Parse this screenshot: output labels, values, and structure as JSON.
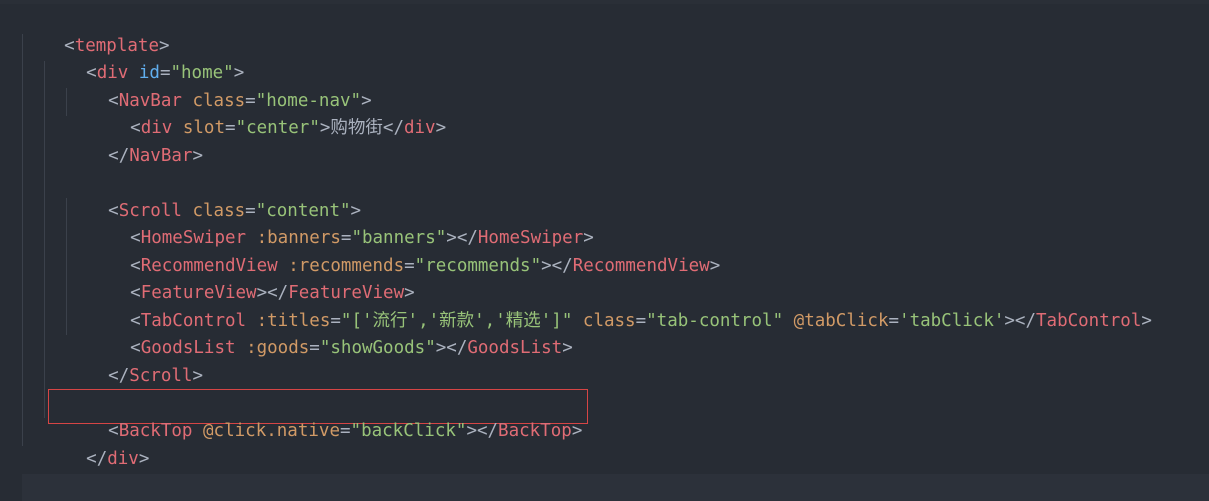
{
  "code": {
    "template_tag": "template",
    "div_tag": "div",
    "div_id_attr": "id",
    "div_id_value": "\"home\"",
    "navbar_tag": "NavBar",
    "navbar_class_attr": "class",
    "navbar_class_value": "\"home-nav\"",
    "center_div_slot_attr": "slot",
    "center_div_slot_value": "\"center\"",
    "center_div_text": "购物街",
    "scroll_tag": "Scroll",
    "scroll_class_attr": "class",
    "scroll_class_value": "\"content\"",
    "homeswiper_tag": "HomeSwiper",
    "homeswiper_attr": ":banners",
    "homeswiper_value": "\"banners\"",
    "recommend_tag": "RecommendView",
    "recommend_attr": ":recommends",
    "recommend_value": "\"recommends\"",
    "feature_tag": "FeatureView",
    "tabcontrol_tag": "TabControl",
    "tabcontrol_titles_attr": ":titles",
    "tabcontrol_titles_value": "\"['流行','新款','精选']\"",
    "tabcontrol_class_attr": "class",
    "tabcontrol_class_value": "\"tab-control\"",
    "tabcontrol_event_attr": "@tabClick",
    "tabcontrol_event_value": "'tabClick'",
    "goodslist_tag": "GoodsList",
    "goodslist_attr": ":goods",
    "goodslist_value": "\"showGoods\"",
    "backtop_tag": "BackTop",
    "backtop_attr": "@click.native",
    "backtop_value": "\"backClick\""
  },
  "colors": {
    "background": "#272c34",
    "tag": "#e06c75",
    "attribute": "#d19a66",
    "id_attribute": "#61afef",
    "string": "#98c379",
    "punctuation": "#abb2bf",
    "highlight_border": "#d64545"
  }
}
